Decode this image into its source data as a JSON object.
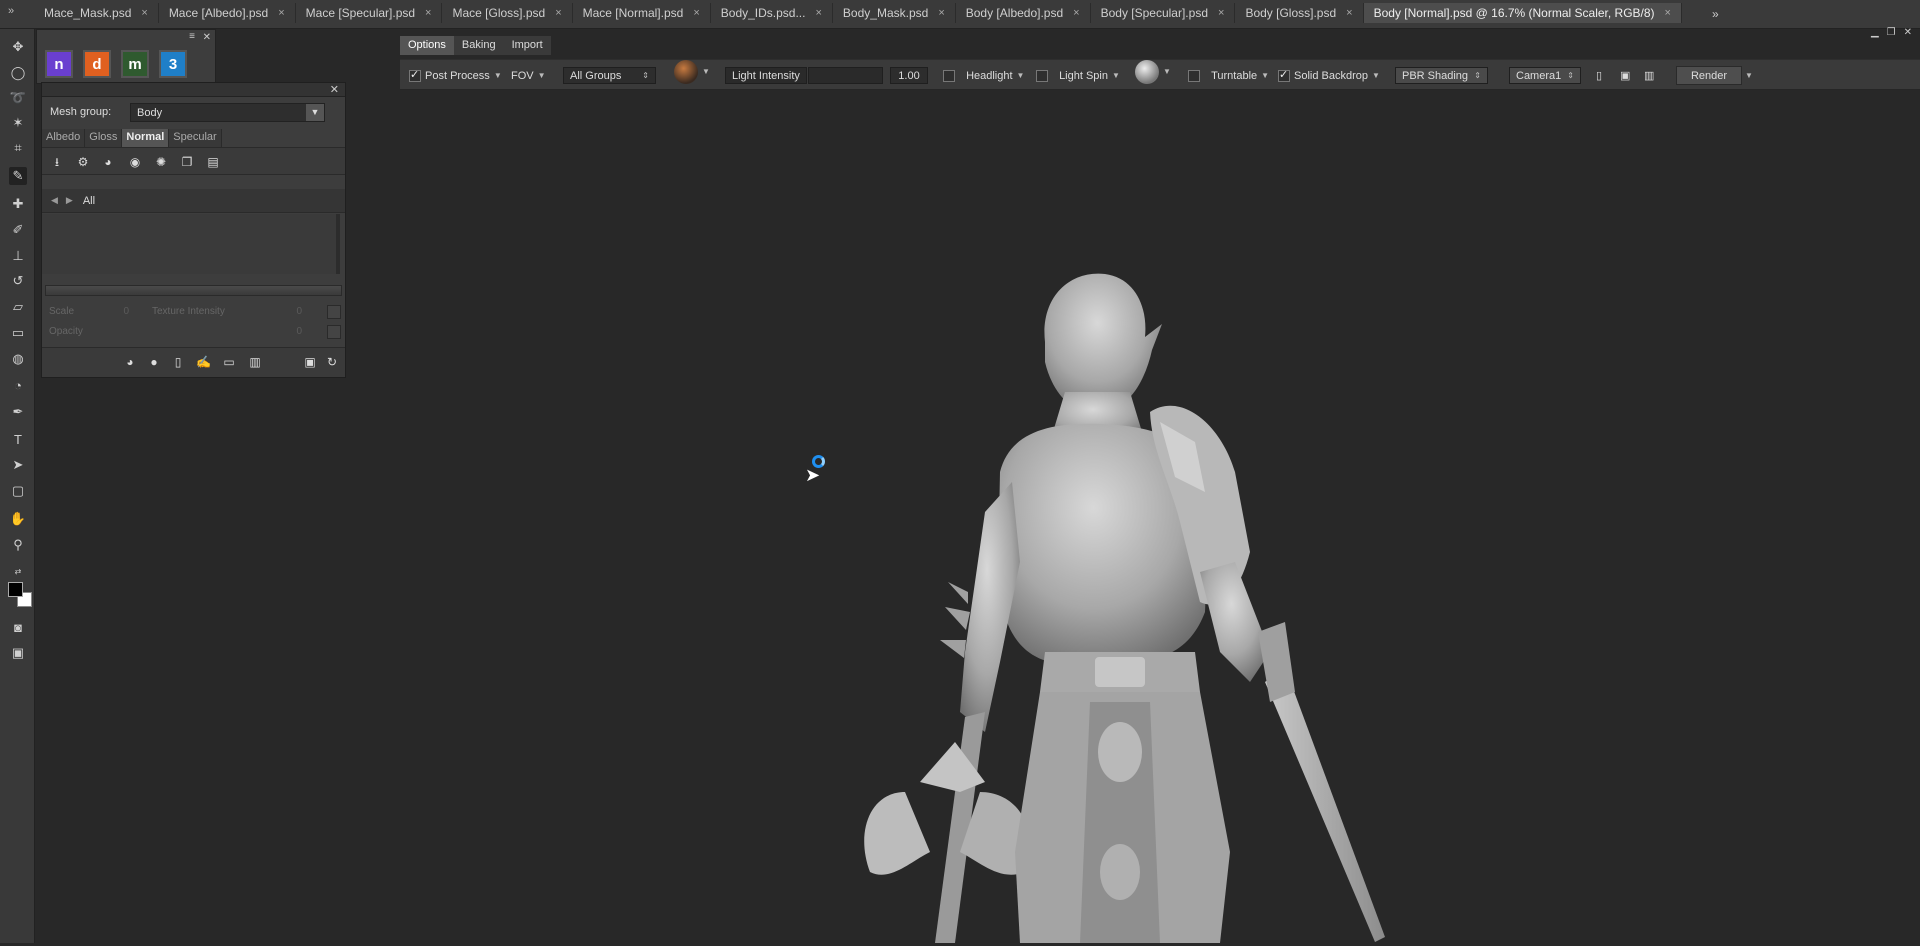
{
  "doc_tabs": [
    {
      "label": "Mace_Mask.psd",
      "active": false
    },
    {
      "label": "Mace [Albedo].psd",
      "active": false
    },
    {
      "label": "Mace [Specular].psd",
      "active": false
    },
    {
      "label": "Mace [Gloss].psd",
      "active": false
    },
    {
      "label": "Mace [Normal].psd",
      "active": false
    },
    {
      "label": "Body_IDs.psd...",
      "active": false
    },
    {
      "label": "Body_Mask.psd",
      "active": false
    },
    {
      "label": "Body [Albedo].psd",
      "active": false
    },
    {
      "label": "Body [Specular].psd",
      "active": false
    },
    {
      "label": "Body [Gloss].psd",
      "active": false
    },
    {
      "label": "Body [Normal].psd @ 16.7% (Normal Scaler, RGB/8)",
      "active": true
    }
  ],
  "tab_close": "×",
  "tab_overflow": "»",
  "plugins": [
    {
      "glyph": "n",
      "color": "#6a3fd0"
    },
    {
      "glyph": "d",
      "color": "#e06020"
    },
    {
      "glyph": "m",
      "color": "#2f5a2f"
    },
    {
      "glyph": "3",
      "color": "#1f7fc8"
    }
  ],
  "panel": {
    "mesh_group_label": "Mesh group:",
    "mesh_group_value": "Body",
    "map_tabs": [
      "Albedo",
      "Gloss",
      "Normal",
      "Specular"
    ],
    "active_map": "Normal",
    "tree_item": "All",
    "scale_label": "Scale",
    "scale_value": "0",
    "texture_intensity_label": "Texture Intensity",
    "texture_intensity_value": "0",
    "opacity_label": "Opacity",
    "opacity_value": "0"
  },
  "option_tabs": [
    "Options",
    "Baking",
    "Import"
  ],
  "options": {
    "post_process": "Post Process",
    "fov": "FOV",
    "groups": "All Groups",
    "light_intensity_label": "Light Intensity",
    "light_intensity_value": "1.00",
    "headlight": "Headlight",
    "light_spin": "Light Spin",
    "turntable": "Turntable",
    "solid_backdrop": "Solid Backdrop",
    "shading": "PBR Shading",
    "camera": "Camera1",
    "render": "Render"
  }
}
